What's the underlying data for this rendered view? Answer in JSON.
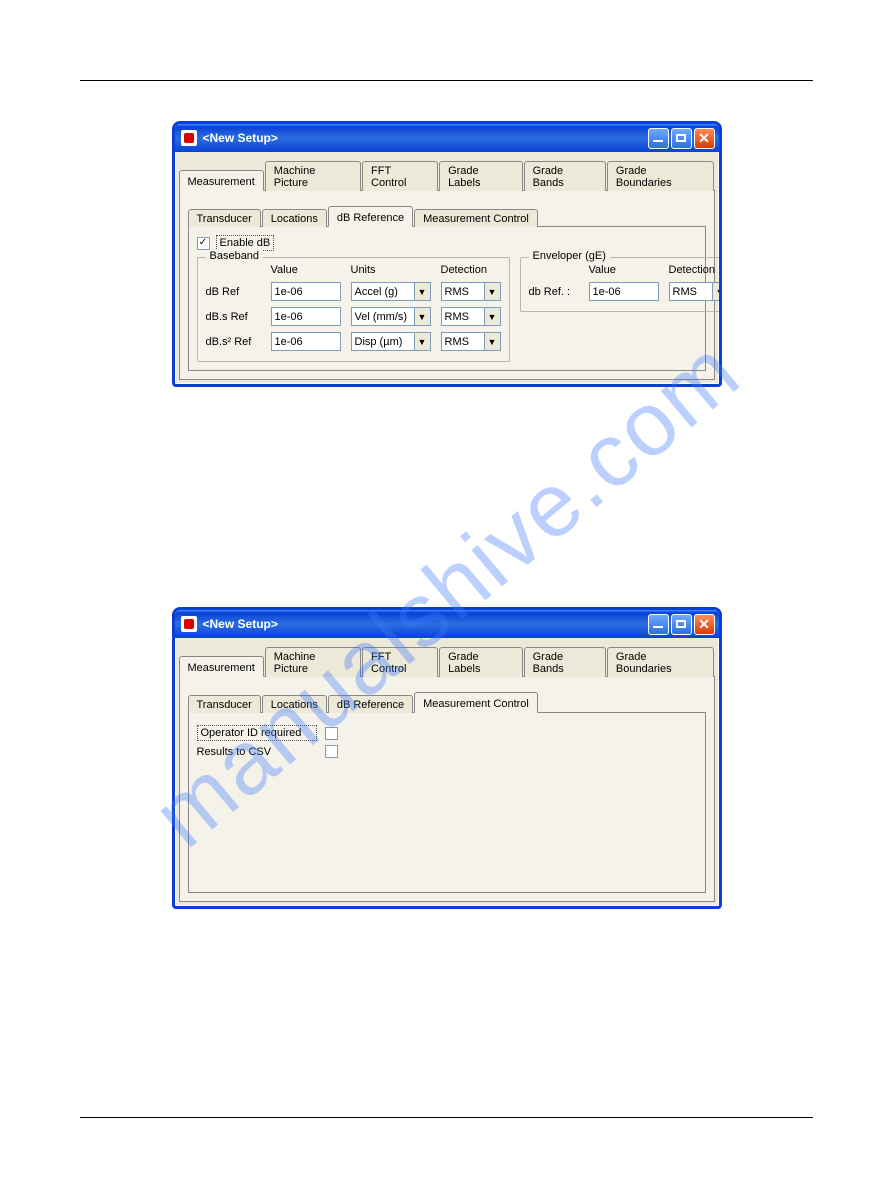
{
  "watermark": "manualshive.com",
  "window1": {
    "title": "<New Setup>",
    "outer_tabs": [
      "Measurement",
      "Machine Picture",
      "FFT Control",
      "Grade Labels",
      "Grade Bands",
      "Grade Boundaries"
    ],
    "outer_active": 0,
    "inner_tabs": [
      "Transducer",
      "Locations",
      "dB Reference",
      "Measurement Control"
    ],
    "inner_active": 2,
    "enable_db_label": "Enable dB",
    "enable_db_checked": "✓",
    "baseband": {
      "legend": "Baseband",
      "cols": {
        "value": "Value",
        "units": "Units",
        "detection": "Detection"
      },
      "rows": [
        {
          "label": "dB Ref",
          "value": "1e-06",
          "units": "Accel (g)",
          "detection": "RMS"
        },
        {
          "label": "dB.s Ref",
          "value": "1e-06",
          "units": "Vel (mm/s)",
          "detection": "RMS"
        },
        {
          "label": "dB.s² Ref",
          "value": "1e-06",
          "units": "Disp (µm)",
          "detection": "RMS"
        }
      ]
    },
    "enveloper": {
      "legend": "Enveloper (gE)",
      "cols": {
        "value": "Value",
        "detection": "Detection"
      },
      "row": {
        "label": "db Ref.  :",
        "value": "1e-06",
        "detection": "RMS"
      }
    }
  },
  "window2": {
    "title": "<New Setup>",
    "outer_tabs": [
      "Measurement",
      "Machine Picture",
      "FFT Control",
      "Grade Labels",
      "Grade Bands",
      "Grade Boundaries"
    ],
    "outer_active": 0,
    "inner_tabs": [
      "Transducer",
      "Locations",
      "dB Reference",
      "Measurement Control"
    ],
    "inner_active": 3,
    "rows": [
      {
        "label": "Operator ID required",
        "checked": ""
      },
      {
        "label": "Results to CSV",
        "checked": ""
      }
    ]
  }
}
